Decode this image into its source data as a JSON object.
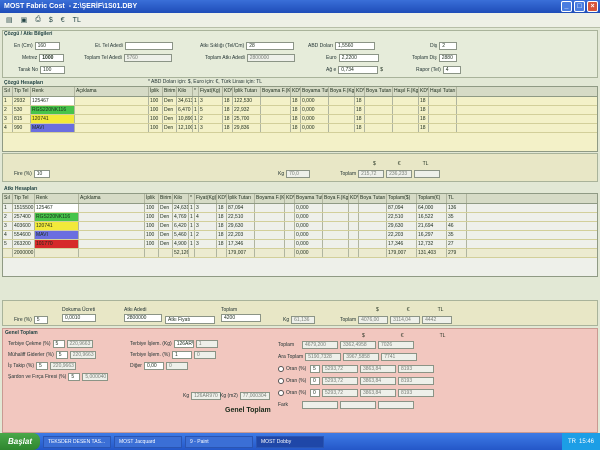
{
  "window": {
    "title": "MOST Fabric Cost",
    "path": "- Z:\\ŞERİF\\1S01.DBY"
  },
  "toolbar": {
    "items": [
      "new-icon",
      "save-icon",
      "print-icon",
      "$",
      "€",
      "TL"
    ]
  },
  "header": {
    "group_label": "Çözgü / Atkı Bilgileri",
    "fields": [
      {
        "label": "En (Cm)",
        "value": "160"
      },
      {
        "label": "Metrez",
        "value": "1000"
      },
      {
        "label": "Tarak No",
        "value": "100"
      },
      {
        "label": "Et. Tel Adedi",
        "value": ""
      },
      {
        "label": "Toplam Tel Adedi",
        "value": "5760"
      },
      {
        "label": "Atkı Sıklığı (Tel/Cm)",
        "value": "28"
      },
      {
        "label": "Toplam Atkı Adedi",
        "value": "2800000"
      },
      {
        "label": "ABD Doları",
        "value": "1,5560"
      },
      {
        "label": "Euro",
        "value": "2,2200"
      },
      {
        "label": "Ağ e",
        "value": "0,734"
      },
      {
        "label": "Diş",
        "value": "2"
      },
      {
        "label": "Toplam Diş",
        "value": "2880"
      },
      {
        "label": "Rapor (Tel)",
        "value": "4"
      }
    ],
    "note": "* ABD Doları için: $, Euro için: €, Türk Lirası için: TL"
  },
  "warp": {
    "label": "Çözgü Hesapları",
    "columns": [
      "Sıl",
      "Tip Tel",
      "Renk",
      "Açıklama",
      "İplik",
      "Birim",
      "Kilo",
      "*",
      "Fiyat(Kg)",
      "KDV",
      "İplik Tutarı",
      "Boyama F.(Kg)",
      "KDV",
      "Boyama Tutarı",
      "Boya F.(Kg)",
      "KDV",
      "Boya Tutarı",
      "Haşıl F.(Kg)",
      "KDV",
      "Haşıl Tutarı"
    ],
    "rows": [
      {
        "sil": "1",
        "tip": "2932",
        "renk": "125467",
        "renk_color": "#ffffff",
        "iplik": "100",
        "birim": "Den",
        "kilo": "34,613",
        "c1": "1",
        "c2": "3",
        "kdv": "18",
        "tutar": "122,530",
        "k2": "18",
        "b": "0,000",
        "k3": "18",
        "k4": "18"
      },
      {
        "sil": "2",
        "tip": "530",
        "renk": "RGS220NK116",
        "renk_color": "#47c44a",
        "iplik": "100",
        "birim": "Den",
        "kilo": "6,470",
        "c1": "1",
        "c2": "5",
        "kdv": "18",
        "tutar": "22,932",
        "k2": "18",
        "b": "0,000",
        "k3": "18",
        "k4": "18"
      },
      {
        "sil": "3",
        "tip": "815",
        "renk": "120741",
        "renk_color": "#f2e93a",
        "iplik": "100",
        "birim": "Den",
        "kilo": "10,890",
        "c1": "1",
        "c2": "2",
        "kdv": "18",
        "tutar": "25,700",
        "k2": "18",
        "b": "0,000",
        "k3": "18",
        "k4": "18"
      },
      {
        "sil": "4",
        "tip": "990",
        "renk": "MAVI",
        "renk_color": "#6a6ee0",
        "iplik": "100",
        "birim": "Den",
        "kilo": "12,100",
        "c1": "1",
        "c2": "3",
        "kdv": "18",
        "tutar": "29,836",
        "k2": "18",
        "b": "0,000",
        "k3": "18",
        "k4": "18"
      }
    ],
    "fire_label": "Fire (%)",
    "fire": "10",
    "kg_label": "Kg",
    "kg": "70,0",
    "toplam_label": "Toplam",
    "totals": [
      "215,72",
      "236,233",
      ""
    ],
    "currency": [
      "$",
      "€",
      "TL"
    ]
  },
  "weft": {
    "label": "Atkı Hesapları",
    "columns": [
      "Sıl",
      "Tip Tel",
      "Renk",
      "Açıklama",
      "İplik",
      "Birim",
      "Kilo",
      "*",
      "Fiyat(Kg)",
      "KDV",
      "İplik Tutarı",
      "Boyama F.(Kg)",
      "KDV",
      "Boyama Tutarı",
      "Boya F.(Kg)",
      "KDV",
      "Boya Tutarı",
      "Toplam($)",
      "Toplam(€)",
      "TL"
    ],
    "rows": [
      {
        "sil": "1",
        "tip": "1515500",
        "renk": "125467",
        "renk_color": "#ffffff",
        "iplik": "100",
        "birim": "Den",
        "kilo": "24,631",
        "c1": "1",
        "c2": "3",
        "kdv": "18",
        "tutar": "87,094",
        "b": "0,000",
        "t1": "87,094",
        "t2": "64,000",
        "t3": "136"
      },
      {
        "sil": "2",
        "tip": "257400",
        "renk": "RGS220NK116",
        "renk_color": "#47c44a",
        "iplik": "100",
        "birim": "Den",
        "kilo": "4,769",
        "c1": "1",
        "c2": "4",
        "kdv": "18",
        "tutar": "22,510",
        "b": "0,000",
        "t1": "22,510",
        "t2": "16,522",
        "t3": "35"
      },
      {
        "sil": "3",
        "tip": "403600",
        "renk": "120741",
        "renk_color": "#f2e93a",
        "iplik": "100",
        "birim": "Den",
        "kilo": "6,420",
        "c1": "1",
        "c2": "3",
        "kdv": "18",
        "tutar": "29,630",
        "b": "0,000",
        "t1": "29,630",
        "t2": "21,694",
        "t3": "46"
      },
      {
        "sil": "4",
        "tip": "554600",
        "renk": "MAVI",
        "renk_color": "#6a6ee0",
        "iplik": "100",
        "birim": "Den",
        "kilo": "5,460",
        "c1": "1",
        "c2": "2",
        "kdv": "18",
        "tutar": "22,203",
        "b": "0,000",
        "t1": "22,203",
        "t2": "16,297",
        "t3": "35"
      },
      {
        "sil": "5",
        "tip": "263200",
        "renk": "101770",
        "renk_color": "#d62a2a",
        "iplik": "100",
        "birim": "Den",
        "kilo": "4,900",
        "c1": "1",
        "c2": "3",
        "kdv": "18",
        "tutar": "17,346",
        "b": "0,000",
        "t1": "17,346",
        "t2": "12,732",
        "t3": "27"
      }
    ],
    "summary": {
      "tip": "2000000",
      "kilo": "52,126",
      "tutar": "179,007",
      "b": "0,000",
      "t1": "179,007",
      "t2": "131,403",
      "t3": "279"
    }
  },
  "weft_footer": {
    "fire_label": "Fire (%)",
    "fire": "5",
    "dokuma_label": "Dokuma Ücreti",
    "dokuma": "0,0010",
    "atki_label": "Atkı Adedi",
    "atki": "2800000",
    "currency": "Atkı Fiyatı",
    "toplam_label": "Toplam",
    "toplam": "4200",
    "kg_label": "Kg",
    "kg": "61,136",
    "t_label": "Toplam",
    "totals": [
      "4076,00",
      "3114,04",
      "4442"
    ],
    "currency_heads": [
      "$",
      "€",
      "TL"
    ]
  },
  "genel": {
    "label": "Genel Toplam",
    "left": [
      {
        "label": "Terbiye Çekme (%)",
        "v": "5",
        "r": "220,9663"
      },
      {
        "label": "Mühaliff Giderler (%)",
        "v": "5",
        "r": "220,9663"
      },
      {
        "label": "İş Takip (%)",
        "v": "5",
        "r": "220,9663"
      },
      {
        "label": "Şardon ve Fırça Firesi (%)",
        "v": "5",
        "r": "5,000040"
      }
    ],
    "mid": [
      {
        "label": "Terbiye İşlem. (Kg)",
        "v": "126ARV",
        "r": "1",
        "r2": "1"
      },
      {
        "label": "Terbiye İşlem. (%)",
        "v": "1",
        "r": "0"
      },
      {
        "label": "Diğer",
        "v": "0,00",
        "r": "0"
      }
    ],
    "kg_label": "Kg",
    "kg": "126AR970",
    "kgm_label": "Kg (m2)",
    "kgm": "77,000304",
    "genel_toplam": "Genel Toplam",
    "right_heads": [
      "$",
      "€",
      "TL"
    ],
    "right_rows": [
      {
        "label": "Toplam",
        "v": [
          "4679,200",
          "3362,4958",
          "7026"
        ]
      },
      {
        "label": "Ara Toplam",
        "v": [
          "5190,7328",
          "3967,5858",
          "7741"
        ]
      },
      {
        "label": "Oran (%)",
        "pct": "5",
        "v": [
          "5293,72",
          "3863,84",
          "8193"
        ]
      },
      {
        "label": "Oran (%)",
        "pct": "0",
        "v": [
          "5293,72",
          "3863,84",
          "8193"
        ]
      },
      {
        "label": "Oran (%)",
        "pct": "0",
        "v": [
          "5293,72",
          "3863,84",
          "8193"
        ]
      },
      {
        "label": "Fark",
        "v": [
          "",
          "",
          ""
        ]
      }
    ]
  },
  "taskbar": {
    "start": "Başlat",
    "tasks": [
      "TEKSDER DESEN TAS...",
      "MOST Jacquard",
      "9 - Paint",
      "MOST Dobby"
    ],
    "clock": "15:46",
    "lang": "TR"
  }
}
